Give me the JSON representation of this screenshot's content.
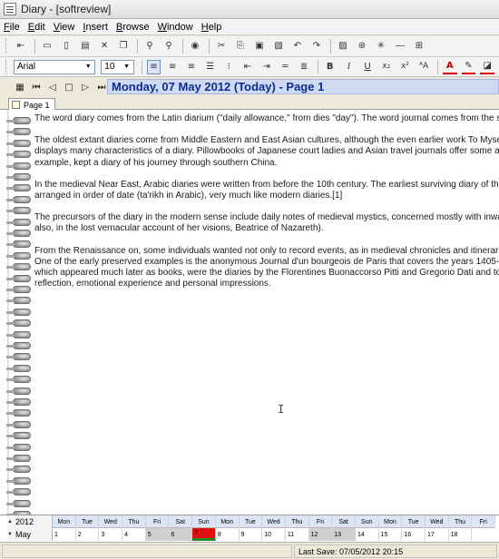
{
  "window": {
    "title": "Diary - [softreview]"
  },
  "menu": [
    {
      "label": "File",
      "hot": "F"
    },
    {
      "label": "Edit",
      "hot": "E"
    },
    {
      "label": "View",
      "hot": "V"
    },
    {
      "label": "Insert",
      "hot": "I"
    },
    {
      "label": "Browse",
      "hot": "B"
    },
    {
      "label": "Window",
      "hot": "W"
    },
    {
      "label": "Help",
      "hot": "H"
    }
  ],
  "format": {
    "font": "Arial",
    "size": "10"
  },
  "navigation": {
    "date_heading": "Monday, 07 May 2012 (Today) - Page 1"
  },
  "tabs": [
    {
      "label": "Page 1"
    }
  ],
  "entry": {
    "paragraphs": [
      "The word diary comes from the Latin diarium (\"daily allowance,\" from dies \"day\"). The word journal comes from the same root",
      "The oldest extant diaries come from Middle Eastern and East Asian cultures, although the even earlier work To Myself (Tà εἰ already displays many characteristics of a diary. Pillowbooks of Japanese court ladies and Asian travel journals offer some a century AD), for example, kept a diary of his journey through southern China.",
      "In the medieval Near East, Arabic diaries were written from before the 10th century. The earliest surviving diary of this era whi to be arranged in order of date (ta'rikh in Arabic), very much like modern diaries.[1]",
      "The precursors of the diary in the modern sense include daily notes of medieval mystics, concerned mostly with inward emot perhaps also, in the lost vernacular account of her visions, Beatrice of Nazareth).",
      "From the Renaissance on, some individuals wanted not only to record events, as in medieval chronicles and itineraries, but a notes. One of the early preserved examples is the anonymous Journal d'un bourgeois de Paris that covers the years 1405-14 examples, which appeared much later as books, were the diaries by the Florentines Buonaccorso Pitti and Gregorio Dati and together with much reflection, emotional experience and personal impressions."
    ]
  },
  "calendar": {
    "year": "2012",
    "month": "May",
    "days": [
      "Mon",
      "Tue",
      "Wed",
      "Thu",
      "Fri",
      "Sat",
      "Sun",
      "Mon",
      "Tue",
      "Wed",
      "Thu",
      "Fri",
      "Sat",
      "Sun",
      "Mon",
      "Tue",
      "Wed",
      "Thu",
      "Fri"
    ],
    "dates": [
      "1",
      "2",
      "3",
      "4",
      "5",
      "6",
      "7",
      "8",
      "9",
      "10",
      "11",
      "12",
      "13",
      "14",
      "15",
      "16",
      "17",
      "18"
    ],
    "today": "7",
    "weekend_dates": [
      "5",
      "6",
      "12",
      "13"
    ],
    "colors": {
      "today": "#e01010",
      "today_underline": "#1b8a2a",
      "weekend": "#cfcfcf"
    }
  },
  "status": {
    "last_save": "Last Save: 07/05/2012 20:15"
  },
  "colors": {
    "date_heading_text": "#0b2d8c",
    "date_heading_bg": "#cfd9f2"
  },
  "toolbar1_icons": [
    "exit-icon",
    "open-icon",
    "new-page-icon",
    "new-entry-icon",
    "delete-icon",
    "copy-page-icon",
    "find-icon",
    "find-next-icon",
    "help-icon",
    "cut-icon",
    "copy-icon",
    "paste-icon",
    "delete-selection-icon",
    "undo-icon",
    "redo-icon",
    "insert-picture-icon",
    "insert-link-icon",
    "insert-symbol-icon",
    "insert-line-icon",
    "insert-table-icon"
  ],
  "toolbar2_icons": [
    "align-left-icon",
    "align-center-icon",
    "align-right-icon",
    "justify-icon",
    "bullets-icon",
    "decrease-indent-icon",
    "increase-indent-icon",
    "paragraph-icon",
    "bold-icon",
    "italic-icon",
    "underline-icon",
    "subscript-icon",
    "superscript-icon",
    "font-size-icon",
    "font-color-icon",
    "highlight-icon",
    "fill-color-icon"
  ]
}
